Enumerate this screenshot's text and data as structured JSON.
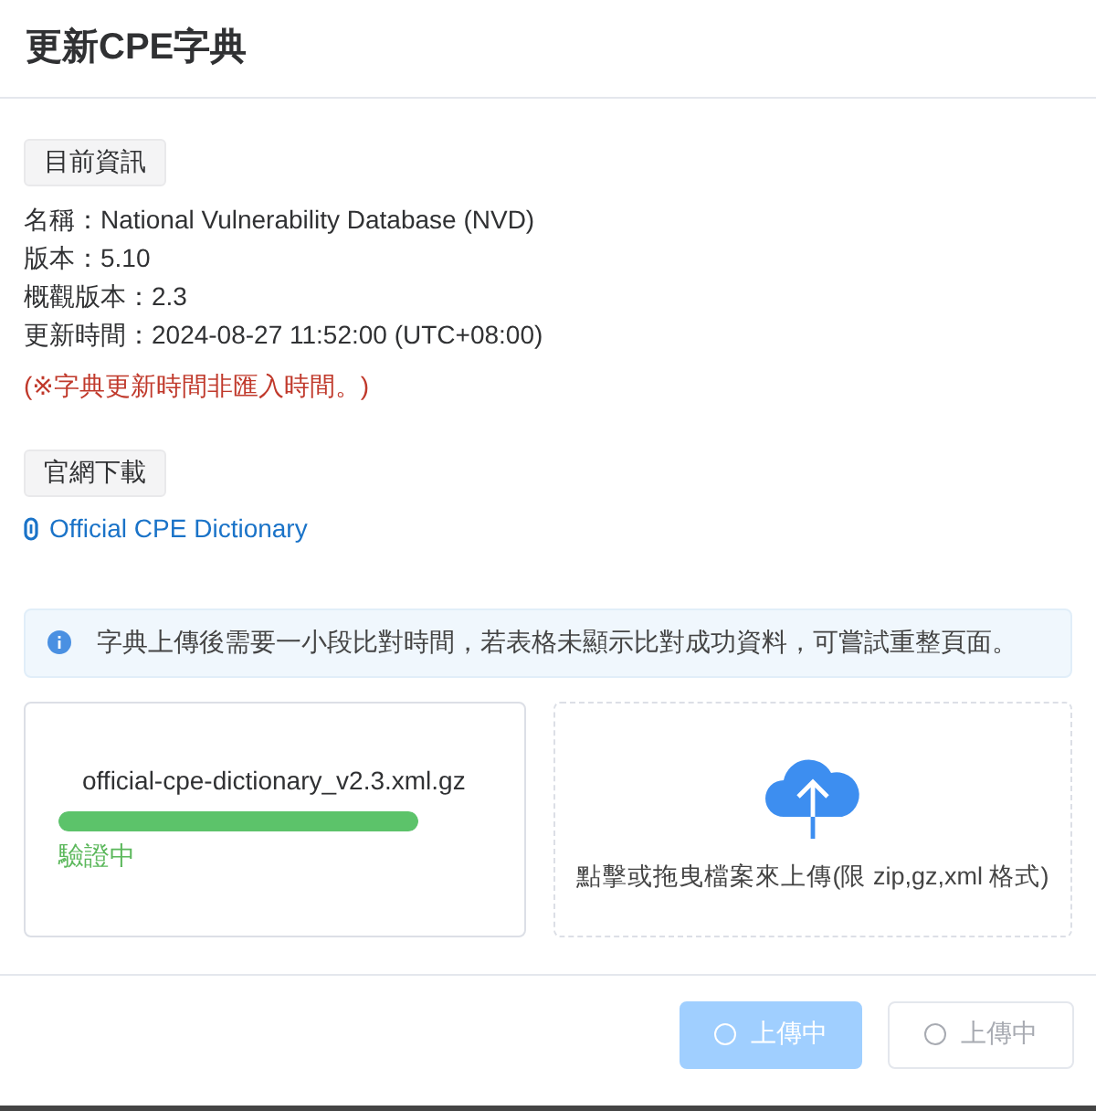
{
  "dialog": {
    "title": "更新CPE字典"
  },
  "current_info": {
    "heading": "目前資訊",
    "lines": [
      "名稱：National Vulnerability Database (NVD)",
      "版本：5.10",
      "概觀版本：2.3",
      "更新時間：2024-08-27 11:52:00 (UTC+08:00)"
    ],
    "note": "(※字典更新時間非匯入時間。)"
  },
  "download": {
    "heading": "官網下載",
    "link": "Official CPE Dictionary"
  },
  "alert": {
    "text": "字典上傳後需要一小段比對時間，若表格未顯示比對成功資料，可嘗試重整頁面。"
  },
  "upload_file": {
    "filename": "official-cpe-dictionary_v2.3.xml.gz",
    "level": 1,
    "status": "驗證中"
  },
  "dropzone": {
    "hint": "點擊或拖曳檔案來上傳(限 zip,gz,xml 格式)"
  },
  "buttons": [
    {
      "label": "上傳中",
      "kind": "primary",
      "disabled": true
    },
    {
      "label": "上傳中",
      "kind": "default",
      "disabled": true
    }
  ]
}
